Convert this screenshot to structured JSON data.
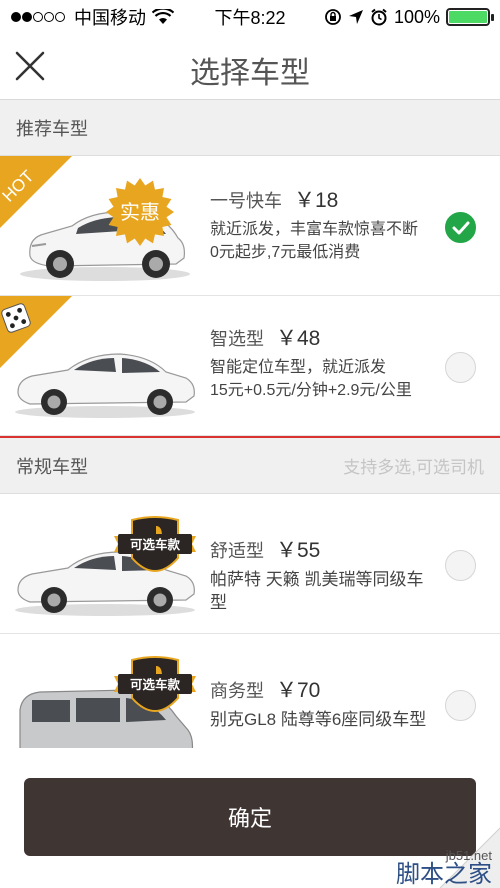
{
  "status_bar": {
    "carrier": "中国移动",
    "time": "下午8:22",
    "battery": "100%",
    "battery_level": 1.0,
    "signal_dots_filled": 2,
    "signal_dots_total": 5,
    "icons": [
      "signal-icon",
      "wifi-icon",
      "rotation-lock-icon",
      "location-icon",
      "alarm-icon",
      "battery-icon"
    ]
  },
  "nav": {
    "title": "选择车型",
    "close_icon": "close-icon"
  },
  "recommended": {
    "header": "推荐车型",
    "items": [
      {
        "name": "一号快车",
        "price": "￥18",
        "desc": "就近派发，丰富车款惊喜不断",
        "fee": "0元起步,7元最低消费",
        "ribbon": "HOT",
        "badge": "实惠",
        "selected": true,
        "car_color": "#f5f5f5"
      },
      {
        "name": "智选型",
        "price": "￥48",
        "desc": "智能定位车型，就近派发",
        "fee": "15元+0.5元/分钟+2.9元/公里",
        "ribbon_icon": "dice-icon",
        "selected": false,
        "car_color": "#f5f5f5"
      }
    ]
  },
  "regular": {
    "header": "常规车型",
    "hint": "支持多选,可选司机",
    "items": [
      {
        "name": "舒适型",
        "price": "￥55",
        "desc": "帕萨特 天籁 凯美瑞等同级车型",
        "badge": "可选车款",
        "selected": false
      },
      {
        "name": "商务型",
        "price": "￥70",
        "desc": "别克GL8 陆尊等6座同级车型",
        "badge": "可选车款",
        "selected": false
      }
    ]
  },
  "confirm_label": "确定",
  "watermark": {
    "url": "jb51.net",
    "name": "脚本之家"
  },
  "colors": {
    "accent_gold": "#e8a620",
    "selected_green": "#22a647",
    "confirm_bg": "#3f3533",
    "divider_red": "#d9332f",
    "badge_dark": "#2b2523"
  }
}
